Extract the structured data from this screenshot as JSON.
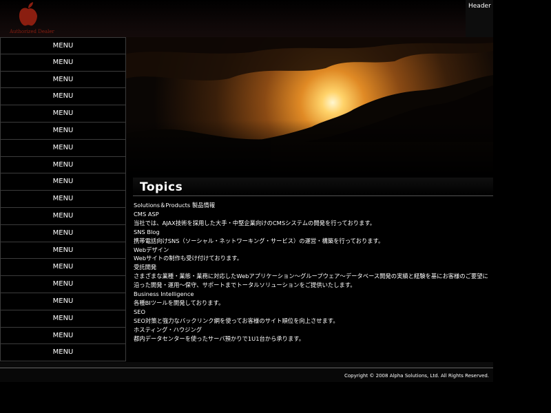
{
  "header": {
    "label": "Header",
    "logo_text": "Authorized Dealer",
    "logo_color": "#8a1e10"
  },
  "menu": {
    "items": [
      "MENU",
      "MENU",
      "MENU",
      "MENU",
      "MENU",
      "MENU",
      "MENU",
      "MENU",
      "MENU",
      "MENU",
      "MENU",
      "MENU",
      "MENU",
      "MENU",
      "MENU",
      "MENU",
      "MENU",
      "MENU",
      "MENU"
    ]
  },
  "topics": {
    "title": "Topics",
    "lines": [
      "Solutions＆Products 製品情報",
      "CMS ASP",
      "当社では、AJAX技術を採用した大手・中堅企業向けのCMSシステムの開発を行っております。",
      "SNS Blog",
      "携帯電話向けSNS（ソーシャル・ネットワーキング・サービス）の運営・構築を行っております。",
      "Webデザイン",
      "Webサイトの制作も受け付けております。",
      "受託開発",
      "さまざまな業種・業態・業務に対応したWebアプリケーション～グループウェア～データベース開発の実績と経験を基にお客様のご要望に沿った開発・運用～保守、サポートまでトータルソリューションをご提供いたします。",
      "Business Intelligence",
      "各種BIツールを開発しております。",
      "SEO",
      "SEO対策と強力なバックリンク網を使ってお客様のサイト順位を向上させます。",
      "ホスティング・ハウジング",
      "都内データセンターを使ったサーバ預かりで1U1台から承ります。"
    ]
  },
  "footer": {
    "copyright": "Copyright © 2008 Alpha Solutions, Ltd. All Rights Reserved."
  }
}
